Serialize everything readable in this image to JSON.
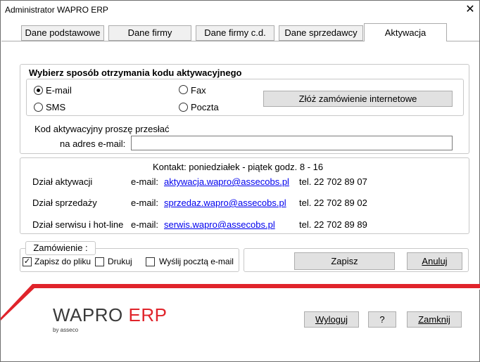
{
  "window": {
    "title": "Administrator WAPRO ERP",
    "close_glyph": "✕"
  },
  "tabs": [
    {
      "label": "Dane podstawowe"
    },
    {
      "label": "Dane firmy"
    },
    {
      "label": "Dane firmy c.d."
    },
    {
      "label": "Dane sprzedawcy"
    },
    {
      "label": "Aktywacja",
      "active": true
    }
  ],
  "method": {
    "title": "Wybierz sposób otrzymania kodu aktywacyjnego",
    "options": {
      "email": "E-mail",
      "sms": "SMS",
      "fax": "Fax",
      "post": "Poczta"
    },
    "selected": "email",
    "order_button": "Złóż zamówienie internetowe",
    "send_label_1": "Kod aktywacyjny proszę przesłać",
    "send_label_2": "na adres e-mail:",
    "email_value": ""
  },
  "contact": {
    "header": "Kontakt: poniedziałek - piątek  godz. 8 - 16",
    "rows": [
      {
        "dept": "Dział aktywacji",
        "email_label": "e-mail:",
        "email": "aktywacja.wapro@assecobs.pl",
        "phone": "tel. 22 702 89 07"
      },
      {
        "dept": "Dział sprzedaży",
        "email_label": "e-mail:",
        "email": "sprzedaz.wapro@assecobs.pl",
        "phone": "tel. 22 702 89 02"
      },
      {
        "dept": "Dział serwisu i hot-line",
        "email_label": "e-mail:",
        "email": "serwis.wapro@assecobs.pl",
        "phone": "tel. 22 702 89 89"
      }
    ]
  },
  "order": {
    "title": "Zamówienie :",
    "save_to_file": {
      "label": "Zapisz do pliku",
      "checked": true
    },
    "print": {
      "label": "Drukuj",
      "checked": false
    },
    "send_email": {
      "label": "Wyślij pocztą e-mail",
      "checked": false
    }
  },
  "buttons": {
    "save": "Zapisz",
    "cancel": "Anuluj",
    "logout": "Wyloguj",
    "help": "?",
    "close": "Zamknij"
  },
  "brand": {
    "name_part1": "WAPRO",
    "name_part2": "ERP",
    "sub": "by asseco",
    "accent": "#e0242b",
    "gray": "#3a3a3a"
  }
}
